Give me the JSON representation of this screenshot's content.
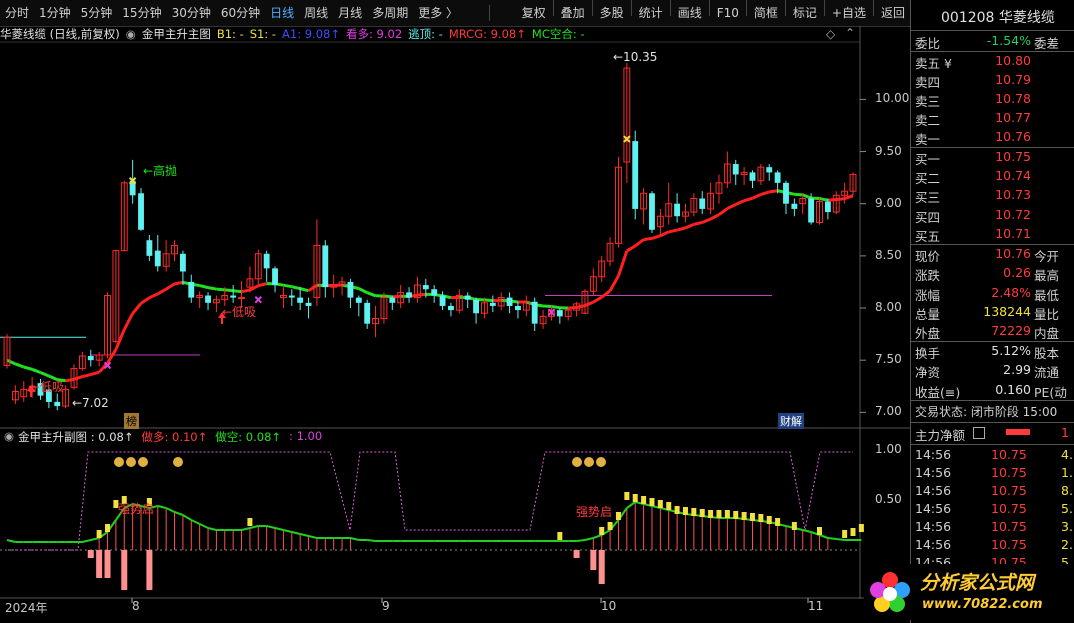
{
  "toolbar": {
    "items": [
      "分时",
      "1分钟",
      "5分钟",
      "15分钟",
      "30分钟",
      "60分钟",
      "日线",
      "周线",
      "月线",
      "多周期",
      "更多 〉"
    ],
    "active_index": 6,
    "right_items": [
      "复权",
      "叠加",
      "多股",
      "统计",
      "画线",
      "F10",
      "简框",
      "标记",
      "+自选",
      "返回"
    ]
  },
  "main_info": {
    "title": "华菱线缆 (日线,前复权)",
    "indicator": "金甲主升主图",
    "b1": "B1: -",
    "s1": "S1: -",
    "a1": "A1: 9.08↑",
    "kanduo": "看多: 9.02",
    "taoding": "逃顶: -",
    "mrcg": "MRCG: 9.08↑",
    "mc": "MC空合: -"
  },
  "sub_info": {
    "title": "金甲主升副图 : 0.08↑",
    "zuoduo": "做多: 0.10↑",
    "zuokong": "做空: 0.08↑",
    "val": ": 1.00"
  },
  "price_axis": [
    "10.00",
    "9.50",
    "9.00",
    "8.50",
    "8.00",
    "7.50",
    "7.00"
  ],
  "sub_axis": [
    "1.00",
    "0.50"
  ],
  "x_axis": [
    "2024年",
    "8",
    "9",
    "10",
    "11"
  ],
  "annotations": {
    "high_label": "←10.35",
    "low_label": "←7.02",
    "gaopao": "←高抛",
    "dixi": "←低吸",
    "dixi2": "←低吸",
    "bang": "榜",
    "caijie": "财解",
    "qiang1": "强势启",
    "qiang2": "强势启"
  },
  "chart_data": {
    "type": "candlestick",
    "ylim": [
      6.85,
      10.55
    ],
    "candles": [
      [
        7.45,
        7.72,
        7.42,
        7.75
      ],
      [
        7.12,
        7.2,
        7.08,
        7.26
      ],
      [
        7.15,
        7.22,
        7.1,
        7.3
      ],
      [
        7.2,
        7.25,
        7.14,
        7.34
      ],
      [
        7.28,
        7.16,
        7.12,
        7.32
      ],
      [
        7.22,
        7.1,
        7.04,
        7.24
      ],
      [
        7.1,
        7.06,
        7.02,
        7.18
      ],
      [
        7.06,
        7.22,
        7.04,
        7.26
      ],
      [
        7.24,
        7.42,
        7.22,
        7.46
      ],
      [
        7.42,
        7.54,
        7.4,
        7.58
      ],
      [
        7.54,
        7.5,
        7.44,
        7.6
      ],
      [
        7.5,
        7.55,
        7.44,
        7.58
      ],
      [
        7.55,
        8.12,
        7.52,
        8.15
      ],
      [
        7.68,
        8.55,
        7.66,
        8.56
      ],
      [
        8.55,
        9.2,
        8.55,
        9.22
      ],
      [
        9.22,
        9.08,
        9.0,
        9.42
      ],
      [
        9.1,
        8.75,
        8.74,
        9.15
      ],
      [
        8.65,
        8.5,
        8.45,
        8.7
      ],
      [
        8.55,
        8.4,
        8.35,
        8.7
      ],
      [
        8.4,
        8.52,
        8.35,
        8.65
      ],
      [
        8.52,
        8.6,
        8.45,
        8.65
      ],
      [
        8.52,
        8.35,
        8.22,
        8.55
      ],
      [
        8.25,
        8.1,
        8.05,
        8.32
      ],
      [
        8.1,
        8.12,
        8.0,
        8.16
      ],
      [
        8.12,
        8.05,
        7.98,
        8.15
      ],
      [
        8.05,
        8.08,
        7.96,
        8.12
      ],
      [
        8.08,
        8.12,
        8.02,
        8.2
      ],
      [
        8.12,
        8.1,
        8.05,
        8.22
      ],
      [
        8.1,
        8.1,
        8.0,
        8.26
      ],
      [
        8.2,
        8.28,
        8.15,
        8.4
      ],
      [
        8.28,
        8.52,
        8.22,
        8.56
      ],
      [
        8.52,
        8.38,
        8.25,
        8.55
      ],
      [
        8.38,
        8.22,
        8.15,
        8.4
      ],
      [
        8.1,
        8.12,
        8.0,
        8.2
      ],
      [
        8.12,
        8.1,
        8.02,
        8.18
      ],
      [
        8.1,
        8.05,
        7.98,
        8.2
      ],
      [
        8.05,
        8.02,
        7.9,
        8.1
      ],
      [
        8.1,
        8.6,
        8.02,
        8.85
      ],
      [
        8.6,
        8.2,
        8.1,
        8.65
      ],
      [
        8.2,
        8.22,
        8.1,
        8.32
      ],
      [
        8.22,
        8.25,
        8.12,
        8.3
      ],
      [
        8.25,
        8.1,
        8.0,
        8.28
      ],
      [
        8.1,
        8.05,
        7.92,
        8.12
      ],
      [
        8.05,
        7.85,
        7.8,
        8.08
      ],
      [
        7.85,
        7.9,
        7.72,
        8.02
      ],
      [
        7.9,
        8.1,
        7.85,
        8.15
      ],
      [
        8.1,
        8.05,
        7.98,
        8.12
      ],
      [
        8.05,
        8.15,
        8.0,
        8.22
      ],
      [
        8.15,
        8.1,
        8.05,
        8.2
      ],
      [
        8.1,
        8.22,
        8.05,
        8.3
      ],
      [
        8.22,
        8.18,
        8.1,
        8.28
      ],
      [
        8.18,
        8.12,
        8.05,
        8.22
      ],
      [
        8.12,
        8.02,
        7.98,
        8.16
      ],
      [
        8.02,
        7.98,
        7.92,
        8.05
      ],
      [
        7.98,
        8.12,
        7.95,
        8.18
      ],
      [
        8.12,
        8.08,
        8.0,
        8.15
      ],
      [
        8.08,
        7.95,
        7.85,
        8.1
      ],
      [
        7.95,
        8.05,
        7.9,
        8.1
      ],
      [
        8.05,
        8.02,
        7.96,
        8.12
      ],
      [
        8.02,
        8.1,
        7.98,
        8.15
      ],
      [
        8.1,
        8.02,
        7.95,
        8.15
      ],
      [
        8.02,
        7.98,
        7.9,
        8.06
      ],
      [
        7.98,
        8.06,
        7.92,
        8.12
      ],
      [
        8.06,
        7.85,
        7.78,
        8.1
      ],
      [
        7.85,
        7.92,
        7.8,
        7.98
      ],
      [
        7.92,
        7.98,
        7.88,
        8.02
      ],
      [
        7.98,
        7.92,
        7.85,
        8.0
      ],
      [
        7.92,
        7.98,
        7.88,
        8.0
      ],
      [
        7.98,
        8.04,
        7.92,
        8.06
      ],
      [
        7.95,
        8.16,
        7.94,
        8.18
      ],
      [
        8.16,
        8.3,
        8.12,
        8.38
      ],
      [
        8.3,
        8.45,
        8.25,
        8.5
      ],
      [
        8.45,
        8.62,
        8.4,
        8.68
      ],
      [
        8.62,
        9.35,
        8.58,
        9.45
      ],
      [
        9.4,
        10.3,
        9.2,
        10.35
      ],
      [
        9.6,
        8.95,
        8.85,
        9.7
      ],
      [
        8.95,
        9.1,
        8.8,
        9.15
      ],
      [
        9.1,
        8.75,
        8.72,
        9.12
      ],
      [
        8.78,
        8.88,
        8.7,
        8.95
      ],
      [
        8.88,
        9.0,
        8.8,
        9.2
      ],
      [
        9.0,
        8.88,
        8.82,
        9.1
      ],
      [
        8.88,
        8.92,
        8.82,
        9.0
      ],
      [
        8.92,
        9.05,
        8.88,
        9.1
      ],
      [
        9.05,
        8.95,
        8.9,
        9.12
      ],
      [
        8.95,
        9.1,
        8.9,
        9.2
      ],
      [
        9.1,
        9.2,
        9.0,
        9.28
      ],
      [
        9.2,
        9.38,
        9.15,
        9.5
      ],
      [
        9.38,
        9.28,
        9.18,
        9.42
      ],
      [
        9.28,
        9.3,
        9.18,
        9.35
      ],
      [
        9.3,
        9.22,
        9.15,
        9.32
      ],
      [
        9.22,
        9.35,
        9.18,
        9.38
      ],
      [
        9.35,
        9.3,
        9.22,
        9.38
      ],
      [
        9.3,
        9.2,
        9.1,
        9.32
      ],
      [
        9.2,
        9.0,
        8.9,
        9.22
      ],
      [
        9.0,
        8.95,
        8.88,
        9.05
      ],
      [
        9.0,
        9.05,
        8.9,
        9.1
      ],
      [
        9.05,
        8.82,
        8.8,
        9.1
      ],
      [
        8.82,
        9.02,
        8.8,
        9.05
      ],
      [
        9.02,
        8.92,
        8.85,
        9.05
      ],
      [
        8.92,
        9.08,
        8.9,
        9.12
      ],
      [
        9.08,
        9.12,
        9.0,
        9.2
      ],
      [
        9.12,
        9.28,
        9.08,
        9.3
      ]
    ],
    "sub_values": [
      0.1,
      0.08,
      0.08,
      0.08,
      0.08,
      0.08,
      0.08,
      0.08,
      0.08,
      0.08,
      0.1,
      0.12,
      0.18,
      0.3,
      0.42,
      0.46,
      0.44,
      0.42,
      0.44,
      0.42,
      0.38,
      0.35,
      0.3,
      0.26,
      0.22,
      0.2,
      0.2,
      0.2,
      0.2,
      0.22,
      0.24,
      0.24,
      0.22,
      0.2,
      0.18,
      0.16,
      0.14,
      0.12,
      0.12,
      0.12,
      0.12,
      0.12,
      0.1,
      0.1,
      0.09,
      0.09,
      0.09,
      0.09,
      0.09,
      0.09,
      0.09,
      0.09,
      0.09,
      0.09,
      0.09,
      0.09,
      0.09,
      0.09,
      0.09,
      0.09,
      0.09,
      0.09,
      0.09,
      0.09,
      0.09,
      0.09,
      0.09,
      0.09,
      0.09,
      0.1,
      0.12,
      0.15,
      0.2,
      0.3,
      0.42,
      0.48,
      0.46,
      0.44,
      0.42,
      0.4,
      0.38,
      0.36,
      0.35,
      0.34,
      0.33,
      0.32,
      0.32,
      0.32,
      0.31,
      0.3,
      0.29,
      0.28,
      0.26,
      0.24,
      0.22,
      0.2,
      0.18,
      0.15,
      0.12,
      0.11,
      0.1,
      0.1,
      0.1
    ]
  },
  "rpanel": {
    "code_name": "001208 华菱线缆",
    "weibi_label": "委比",
    "weibi_val": "-1.54%",
    "weicha_label": "委差",
    "sell": [
      [
        "卖五 ¥",
        "10.80"
      ],
      [
        "卖四",
        "10.79"
      ],
      [
        "卖三",
        "10.78"
      ],
      [
        "卖二",
        "10.77"
      ],
      [
        "卖一",
        "10.76"
      ]
    ],
    "buy": [
      [
        "买一",
        "10.75"
      ],
      [
        "买二",
        "10.74"
      ],
      [
        "买三",
        "10.73"
      ],
      [
        "买四",
        "10.72"
      ],
      [
        "买五",
        "10.71"
      ]
    ],
    "quote": [
      [
        "现价",
        "10.76",
        "今开"
      ],
      [
        "涨跌",
        "0.26",
        "最高"
      ],
      [
        "涨幅",
        "2.48%",
        "最低"
      ],
      [
        "总量",
        "138244",
        "量比"
      ],
      [
        "外盘",
        "72229",
        "内盘"
      ]
    ],
    "quote2": [
      [
        "换手",
        "5.12%",
        "股本"
      ],
      [
        "净资",
        "2.99",
        "流通"
      ],
      [
        "收益(≡)",
        "0.160",
        "PE(动"
      ]
    ],
    "status": "交易状态: 闭市阶段 15:00",
    "flow_label": "主力净额",
    "ticks": [
      [
        "14:56",
        "10.75",
        "4."
      ],
      [
        "14:56",
        "10.75",
        "1."
      ],
      [
        "14:56",
        "10.75",
        "8."
      ],
      [
        "14:56",
        "10.75",
        "5."
      ],
      [
        "14:56",
        "10.75",
        "3."
      ],
      [
        "14:56",
        "10.75",
        "2."
      ],
      [
        "14:56",
        "10.75",
        "5"
      ]
    ]
  },
  "watermark": {
    "line1": "分析家公式网",
    "line2": "www.70822.com"
  },
  "colors": {
    "up": "#ff2a2a",
    "down": "#5ff0f0",
    "ma_up": "#ff2020",
    "ma_down": "#20e020",
    "purple": "#c040c0"
  }
}
